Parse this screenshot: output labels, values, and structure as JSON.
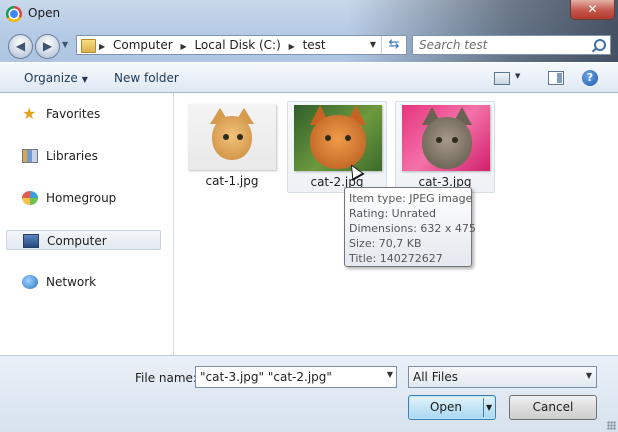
{
  "window": {
    "title": "Open",
    "close_glyph": "✕"
  },
  "nav": {
    "back_glyph": "◀",
    "forward_glyph": "▶",
    "breadcrumb": [
      "Computer",
      "Local Disk (C:)",
      "test"
    ],
    "search_placeholder": "Search test"
  },
  "toolbar": {
    "organize_label": "Organize",
    "new_folder_label": "New folder",
    "help_glyph": "?"
  },
  "sidebar": {
    "items": [
      {
        "label": "Favorites",
        "icon": "star-icon"
      },
      {
        "label": "Libraries",
        "icon": "libraries-icon"
      },
      {
        "label": "Homegroup",
        "icon": "homegroup-icon"
      },
      {
        "label": "Computer",
        "icon": "computer-icon",
        "selected": true
      },
      {
        "label": "Network",
        "icon": "network-icon"
      }
    ]
  },
  "files": [
    {
      "name": "cat-1.jpg"
    },
    {
      "name": "cat-2.jpg"
    },
    {
      "name": "cat-3.jpg"
    }
  ],
  "tooltip": {
    "lines": [
      "Item type: JPEG image",
      "Rating: Unrated",
      "Dimensions: 632 x 475",
      "Size: 70,7 KB",
      "Title: 140272627"
    ]
  },
  "bottom": {
    "file_name_label": "File name:",
    "file_name_value": "\"cat-3.jpg\" \"cat-2.jpg\"",
    "file_type": "All Files",
    "open_label": "Open",
    "cancel_label": "Cancel"
  },
  "colors": {
    "title_bg": "#b6cbe4",
    "selection_border": "#c9d3df",
    "open_button": "#c4e5f6"
  }
}
